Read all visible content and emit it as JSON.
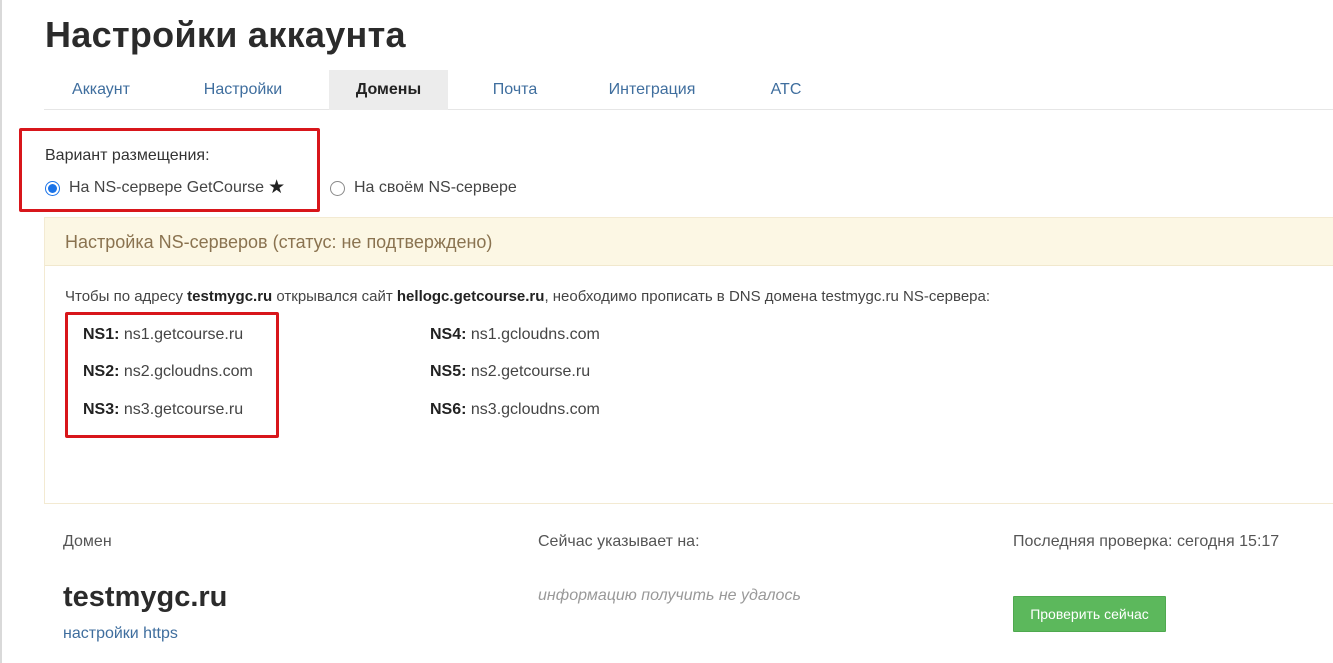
{
  "page": {
    "title": "Настройки аккаунта"
  },
  "tabs": [
    {
      "label": "Аккаунт",
      "active": false
    },
    {
      "label": "Настройки",
      "active": false
    },
    {
      "label": "Домены",
      "active": true
    },
    {
      "label": "Почта",
      "active": false
    },
    {
      "label": "Интеграция",
      "active": false
    },
    {
      "label": "АТС",
      "active": false
    }
  ],
  "placement": {
    "label": "Вариант размещения:",
    "options": [
      {
        "label": "На NS-сервере GetCourse",
        "checked": true,
        "icon": "star-icon",
        "icon_glyph": "★"
      },
      {
        "label": "На своём NS-сервере",
        "checked": false
      }
    ]
  },
  "ns_setup": {
    "header": "Настройка NS-серверов (статус: не подтверждено)",
    "info": {
      "prefix": "Чтобы по адресу ",
      "domain": "testmygc.ru",
      "middle": " открывался сайт ",
      "site": "hellogc.getcourse.ru",
      "suffix": ", необходимо прописать в DNS домена testmygc.ru NS-сервера:"
    },
    "servers": [
      {
        "key": "NS1:",
        "value": "ns1.getcourse.ru"
      },
      {
        "key": "NS2:",
        "value": "ns2.gcloudns.com"
      },
      {
        "key": "NS3:",
        "value": "ns3.getcourse.ru"
      },
      {
        "key": "NS4:",
        "value": "ns1.gcloudns.com"
      },
      {
        "key": "NS5:",
        "value": "ns2.getcourse.ru"
      },
      {
        "key": "NS6:",
        "value": "ns3.gcloudns.com"
      }
    ]
  },
  "domain_table": {
    "col_domain": "Домен",
    "col_pointing": "Сейчас указывает на:",
    "col_check": "Последняя проверка: сегодня 15:17",
    "domain": "testmygc.ru",
    "https_link": "настройки https",
    "pointing_value": "информацию получить не удалось",
    "check_button": "Проверить сейчас"
  },
  "colors": {
    "accent_link": "#3f6e9e",
    "highlight": "#d8161b",
    "button": "#5cb85c",
    "panel_header_bg": "#fcf7e4"
  }
}
